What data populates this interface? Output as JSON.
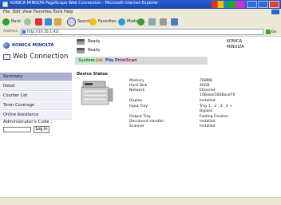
{
  "window": {
    "title": "KONICA MINOLTA PageScope Web Connection - Microsoft Internet Explorer"
  },
  "menubar": {
    "items": [
      "File",
      "Edit",
      "View",
      "Favorites",
      "Tools",
      "Help"
    ]
  },
  "toolbar": {
    "back": "Back",
    "search": "Search",
    "favorites": "Favorites",
    "media": "Media"
  },
  "address": {
    "label": "Address",
    "url": "http://10.10.1.92/",
    "go": "Go"
  },
  "sidebar": {
    "logo": "KONICA MINOLTA",
    "app_title": "Web Connection",
    "nav": [
      {
        "label": "Summary",
        "active": true
      },
      {
        "label": "Detail",
        "active": false
      },
      {
        "label": "Counter List",
        "active": false
      },
      {
        "label": "Toner Coverage",
        "active": false
      },
      {
        "label": "Online Assistance",
        "active": false
      }
    ],
    "admin_label": "Administrator's Code :",
    "login_button": "Log in"
  },
  "main": {
    "status_lines": [
      "Ready",
      "Ready"
    ],
    "brand_line1": "KONICA",
    "brand_line2": "MINOLTA",
    "tabs": [
      {
        "label": "System",
        "color": "#1e8a2a"
      },
      {
        "label": "Job",
        "color": "#b8860b"
      },
      {
        "label": "File",
        "color": "#1e3b8a"
      },
      {
        "label": "Print",
        "color": "#7a1e8a"
      },
      {
        "label": "Scan",
        "color": "#b22222"
      }
    ],
    "device_status_heading": "Device Status",
    "device_info": [
      {
        "key": "Memory",
        "value": "768MB"
      },
      {
        "key": "Hard Disk",
        "value": "40GB"
      },
      {
        "key": "Network",
        "value": "Ethernet"
      },
      {
        "key": "",
        "value": "10Base/100BaseTX"
      },
      {
        "key": "Duplex",
        "value": "Installed"
      },
      {
        "key": "Input Tray",
        "value": "Tray 1 , 2 , 3 , 4 +"
      },
      {
        "key": "",
        "value": "Bypass"
      },
      {
        "key": "Output Tray",
        "value": "Folding Finisher"
      },
      {
        "key": "Document Handler",
        "value": "Installed"
      },
      {
        "key": "Scanner",
        "value": "Installed"
      }
    ]
  }
}
